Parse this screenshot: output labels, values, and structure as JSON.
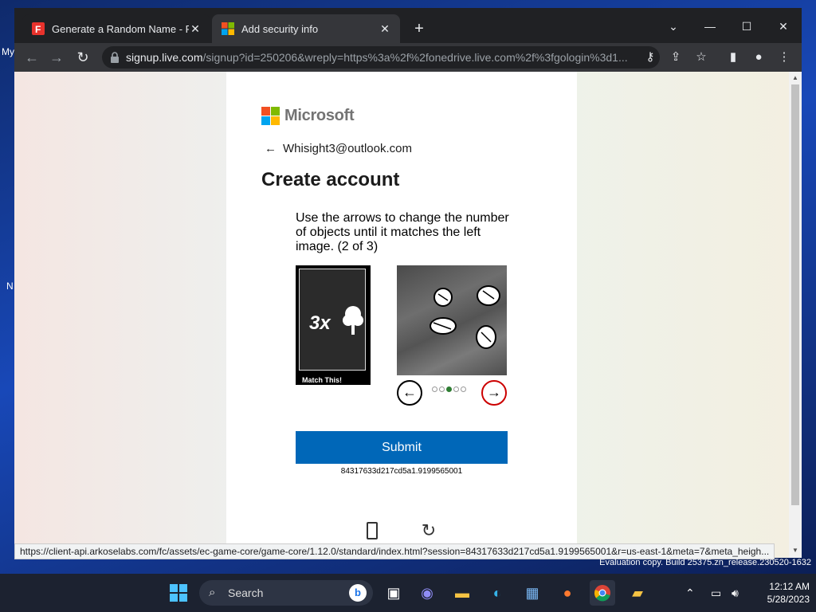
{
  "desktop": {
    "side_text_1": "My",
    "side_text_2": "N"
  },
  "browser": {
    "tabs": [
      {
        "title": "Generate a Random Name - Fake",
        "favicon": "fakename-icon",
        "favicon_color": "#e8322c",
        "favicon_letter": "F"
      },
      {
        "title": "Add security info",
        "favicon": "microsoft-icon"
      }
    ],
    "address": {
      "host": "signup.live.com",
      "path": "/signup?id=250206&wreply=https%3a%2f%2fonedrive.live.com%2f%3fgologin%3d1..."
    },
    "status_url": "https://client-api.arkoselabs.com/fc/assets/ec-game-core/game-core/1.12.0/standard/index.html?session=84317633d217cd5a1.9199565001&r=us-east-1&meta=7&meta_heigh..."
  },
  "page": {
    "brand": "Microsoft",
    "identity_email": "Whisight3@outlook.com",
    "heading": "Create account",
    "instruction": "Use the arrows to change the number of objects until it matches the left image. (2 of 3)",
    "match_count": "3x",
    "match_label": "Match This!",
    "carousel_dots_total": 5,
    "carousel_dot_active": 3,
    "submit_label": "Submit",
    "session_id": "84317633d217cd5a1.9199565001"
  },
  "os": {
    "watermark": "Evaluation copy. Build 25375.zn_release.230520-1632",
    "taskbar_search_placeholder": "Search",
    "clock_time": "12:12 AM",
    "clock_date": "5/28/2023"
  },
  "colors": {
    "accent_blue": "#0067b8",
    "chrome_dark": "#202124",
    "chrome_toolbar": "#35363a",
    "dot_active": "#2e7d32"
  }
}
